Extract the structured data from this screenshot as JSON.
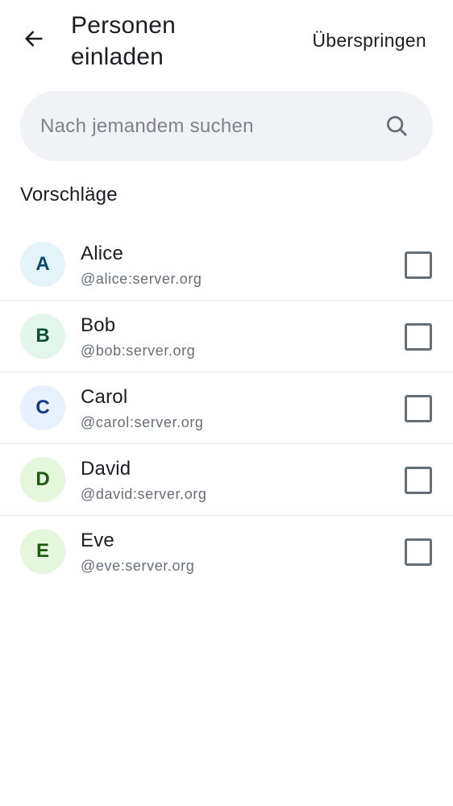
{
  "header": {
    "back_icon": "arrow-left-icon",
    "title": "Personen einladen",
    "skip_label": "Überspringen"
  },
  "search": {
    "placeholder": "Nach jemandem suchen",
    "icon": "search-icon"
  },
  "suggestions": {
    "title": "Vorschläge",
    "items": [
      {
        "initial": "A",
        "name": "Alice",
        "user_id": "@alice:server.org",
        "avatar_bg": "#e3f3f8",
        "avatar_fg": "#0a4a6e",
        "checked": false
      },
      {
        "initial": "B",
        "name": "Bob",
        "user_id": "@bob:server.org",
        "avatar_bg": "#e2f6ec",
        "avatar_fg": "#0c5133",
        "checked": false
      },
      {
        "initial": "C",
        "name": "Carol",
        "user_id": "@carol:server.org",
        "avatar_bg": "#e6f0fe",
        "avatar_fg": "#0f3a8a",
        "checked": false
      },
      {
        "initial": "D",
        "name": "David",
        "user_id": "@david:server.org",
        "avatar_bg": "#e4f6dc",
        "avatar_fg": "#1d5a10",
        "checked": false
      },
      {
        "initial": "E",
        "name": "Eve",
        "user_id": "@eve:server.org",
        "avatar_bg": "#e4f6dc",
        "avatar_fg": "#1d5a10",
        "checked": false
      }
    ]
  }
}
